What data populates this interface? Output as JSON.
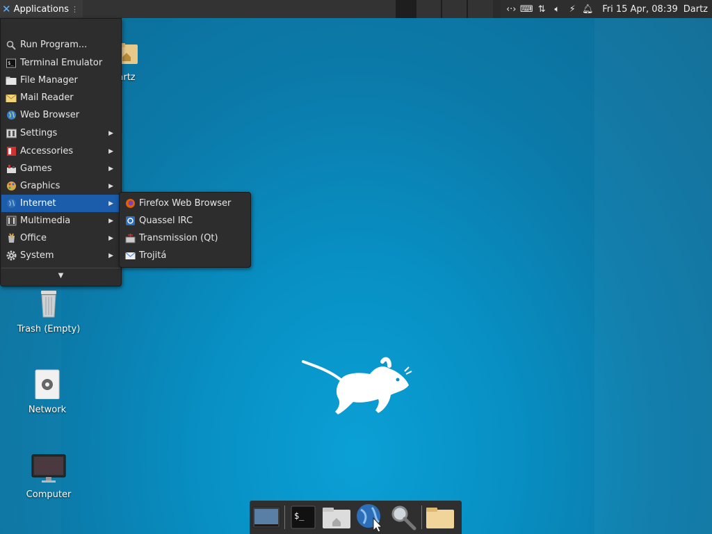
{
  "panel": {
    "applications_label": "Applications",
    "clock": "Fri 15 Apr, 08:39",
    "user": "Dartz",
    "tray_icons": [
      "network-icon",
      "keyboard-icon",
      "transfer-icon",
      "volume-icon",
      "power-icon",
      "notification-bell-icon"
    ]
  },
  "menu": {
    "items": [
      {
        "label": "Run Program...",
        "icon": "search-icon",
        "submenu": false
      },
      {
        "label": "Terminal Emulator",
        "icon": "terminal-icon",
        "submenu": false
      },
      {
        "label": "File Manager",
        "icon": "folder-icon",
        "submenu": false
      },
      {
        "label": "Mail Reader",
        "icon": "mail-icon",
        "submenu": false
      },
      {
        "label": "Web Browser",
        "icon": "globe-icon",
        "submenu": false
      },
      {
        "label": "Settings",
        "icon": "settings-icon",
        "submenu": true
      },
      {
        "label": "Accessories",
        "icon": "accessories-icon",
        "submenu": true
      },
      {
        "label": "Games",
        "icon": "games-icon",
        "submenu": true
      },
      {
        "label": "Graphics",
        "icon": "palette-icon",
        "submenu": true
      },
      {
        "label": "Internet",
        "icon": "globe-icon",
        "submenu": true,
        "active": true
      },
      {
        "label": "Multimedia",
        "icon": "multimedia-icon",
        "submenu": true
      },
      {
        "label": "Office",
        "icon": "office-icon",
        "submenu": true
      },
      {
        "label": "System",
        "icon": "gear-icon",
        "submenu": true
      }
    ]
  },
  "submenu": {
    "items": [
      {
        "label": "Firefox Web Browser",
        "icon": "firefox-icon"
      },
      {
        "label": "Quassel IRC",
        "icon": "quassel-icon"
      },
      {
        "label": "Transmission (Qt)",
        "icon": "transmission-icon"
      },
      {
        "label": "Trojitá",
        "icon": "trojita-icon"
      }
    ]
  },
  "desktop": {
    "home_label": "Dartz",
    "trash_label": "Trash (Empty)",
    "network_label": "Network",
    "computer_label": "Computer"
  },
  "dock": {
    "items": [
      "show-desktop-icon",
      "terminal-icon",
      "home-folder-icon",
      "web-browser-icon",
      "app-finder-icon",
      "folder-icon"
    ]
  },
  "colors": {
    "panel": "#2b2b2b",
    "menu_bg": "#2d2d2d",
    "highlight": "#1b5cab",
    "wallpaper": "#0890c4"
  }
}
